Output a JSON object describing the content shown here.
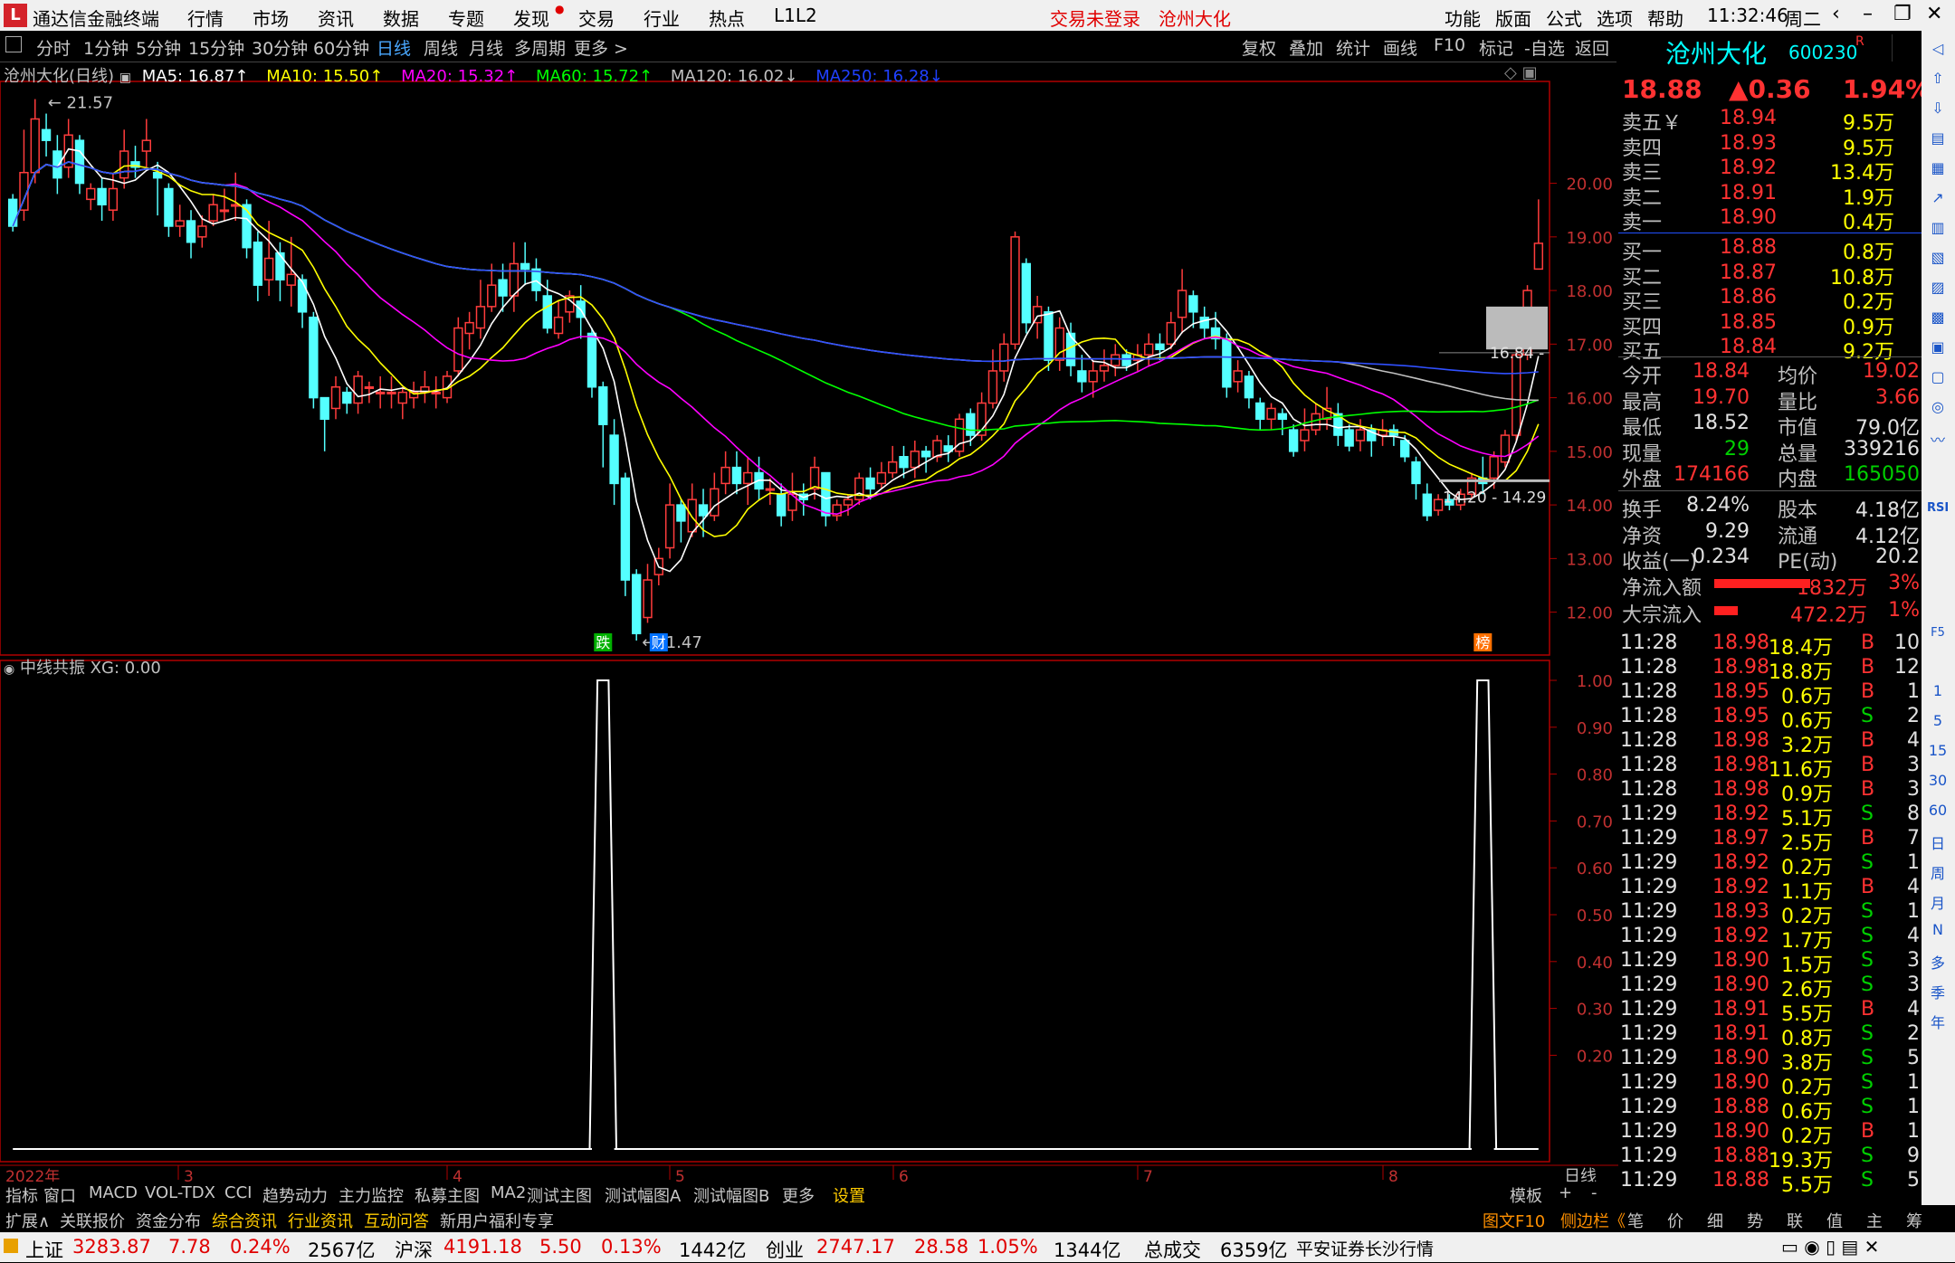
{
  "menubar": {
    "app_title": "通达信金融终端",
    "menus": [
      "行情",
      "市场",
      "资讯",
      "数据",
      "专题",
      "发现",
      "交易",
      "行业",
      "热点",
      "L1L2"
    ],
    "login_status": "交易未登录",
    "stock_name": "沧州大化",
    "right_menus": [
      "功能",
      "版面",
      "公式",
      "选项",
      "帮助"
    ],
    "time": "11:32:46",
    "weekday": "周二"
  },
  "period_bar": {
    "items": [
      "分时",
      "1分钟",
      "5分钟",
      "15分钟",
      "30分钟",
      "60分钟",
      "日线",
      "周线",
      "月线",
      "多周期",
      "更多 >"
    ],
    "selected": "日线",
    "right_items": [
      "复权",
      "叠加",
      "统计",
      "画线",
      "F10",
      "标记",
      "-自选",
      "返回"
    ]
  },
  "main_chart": {
    "title": "沧州大化(日线)",
    "ma": [
      {
        "label": "MA5: 16.87↑",
        "color": "#ffffff"
      },
      {
        "label": "MA10: 15.50↑",
        "color": "#ffff00"
      },
      {
        "label": "MA20: 15.32↑",
        "color": "#ff00ff"
      },
      {
        "label": "MA60: 15.72↑",
        "color": "#00ff00"
      },
      {
        "label": "MA120: 16.02↓",
        "color": "#c0c0c0"
      },
      {
        "label": "MA250: 16.28↓",
        "color": "#2040ff"
      }
    ],
    "y_ticks": [
      "20.00",
      "19.00",
      "18.00",
      "17.00",
      "16.00",
      "15.00",
      "14.00",
      "13.00",
      "12.00"
    ],
    "high_label": "21.57",
    "low_label": "11.47",
    "range_label_1": "16.84 -",
    "range_label_2": "14.20 - 14.29",
    "event_markers": [
      "跌",
      "财",
      "榜"
    ],
    "x_labels": [
      "2022年",
      "3",
      "4",
      "5",
      "6",
      "7",
      "8"
    ],
    "x_right_label": "日线"
  },
  "chart_data": {
    "type": "candlestick",
    "candles_ohlc": [
      [
        19.7,
        19.2,
        19.1,
        19.8
      ],
      [
        19.5,
        20.2,
        19.3,
        21.0
      ],
      [
        20.2,
        21.2,
        20.0,
        21.57
      ],
      [
        21.0,
        20.8,
        20.5,
        21.3
      ],
      [
        20.6,
        20.1,
        19.8,
        20.9
      ],
      [
        20.3,
        20.9,
        20.1,
        21.2
      ],
      [
        20.8,
        20.0,
        19.8,
        20.9
      ],
      [
        19.7,
        19.9,
        19.5,
        20.0
      ],
      [
        19.9,
        19.6,
        19.3,
        20.1
      ],
      [
        19.5,
        19.9,
        19.3,
        20.2
      ],
      [
        20.1,
        20.6,
        19.9,
        21.0
      ],
      [
        20.4,
        20.3,
        20.1,
        20.7
      ],
      [
        20.6,
        20.8,
        20.3,
        21.2
      ],
      [
        20.2,
        20.1,
        19.4,
        20.4
      ],
      [
        19.9,
        19.2,
        19.0,
        20.0
      ],
      [
        19.2,
        19.3,
        19.0,
        19.6
      ],
      [
        19.3,
        18.9,
        18.6,
        19.5
      ],
      [
        19.0,
        19.2,
        18.8,
        19.4
      ],
      [
        19.3,
        19.6,
        19.2,
        19.8
      ],
      [
        19.5,
        19.5,
        19.3,
        19.9
      ],
      [
        19.6,
        19.6,
        19.3,
        20.2
      ],
      [
        19.6,
        18.8,
        18.6,
        19.7
      ],
      [
        18.9,
        18.1,
        17.8,
        19.1
      ],
      [
        18.2,
        18.6,
        17.9,
        19.3
      ],
      [
        18.7,
        18.2,
        17.8,
        18.9
      ],
      [
        18.1,
        18.3,
        17.7,
        19.0
      ],
      [
        18.2,
        17.6,
        17.3,
        18.3
      ],
      [
        17.5,
        16.0,
        15.8,
        17.6
      ],
      [
        16.0,
        15.6,
        15.0,
        16.0
      ],
      [
        15.8,
        16.2,
        15.6,
        16.4
      ],
      [
        16.1,
        15.9,
        15.7,
        16.2
      ],
      [
        15.9,
        16.4,
        15.7,
        16.5
      ],
      [
        16.2,
        16.2,
        15.9,
        16.3
      ],
      [
        16.1,
        16.1,
        15.8,
        16.4
      ],
      [
        16.1,
        16.1,
        15.8,
        16.4
      ],
      [
        15.9,
        16.1,
        15.6,
        16.2
      ],
      [
        16.0,
        16.1,
        15.8,
        16.3
      ],
      [
        16.1,
        16.2,
        15.9,
        16.5
      ],
      [
        16.1,
        16.1,
        15.8,
        16.4
      ],
      [
        16.0,
        16.4,
        15.9,
        16.5
      ],
      [
        16.5,
        17.3,
        16.4,
        17.5
      ],
      [
        17.2,
        17.4,
        16.9,
        17.6
      ],
      [
        17.3,
        17.7,
        17.1,
        18.2
      ],
      [
        17.7,
        18.1,
        17.6,
        18.5
      ],
      [
        18.2,
        17.9,
        17.6,
        18.5
      ],
      [
        17.9,
        18.5,
        17.6,
        18.9
      ],
      [
        18.5,
        18.4,
        18.1,
        18.9
      ],
      [
        18.4,
        18.0,
        17.8,
        18.6
      ],
      [
        17.9,
        17.3,
        17.2,
        18.2
      ],
      [
        17.2,
        17.5,
        17.1,
        17.8
      ],
      [
        17.6,
        17.9,
        17.4,
        18.0
      ],
      [
        17.8,
        17.5,
        17.1,
        18.1
      ],
      [
        17.2,
        16.2,
        16.0,
        17.3
      ],
      [
        16.2,
        15.5,
        14.7,
        16.3
      ],
      [
        15.3,
        14.4,
        14.0,
        15.6
      ],
      [
        14.5,
        12.6,
        12.3,
        14.6
      ],
      [
        12.7,
        11.6,
        11.47,
        12.8
      ],
      [
        11.9,
        12.6,
        11.8,
        12.9
      ],
      [
        12.7,
        13.0,
        12.5,
        13.2
      ],
      [
        13.2,
        14.0,
        13.0,
        14.4
      ],
      [
        14.0,
        13.7,
        13.3,
        14.1
      ],
      [
        13.5,
        14.1,
        13.4,
        14.4
      ],
      [
        14.0,
        13.8,
        13.4,
        14.3
      ],
      [
        13.8,
        14.3,
        13.7,
        14.6
      ],
      [
        14.4,
        14.7,
        14.2,
        15.0
      ],
      [
        14.7,
        14.4,
        14.2,
        15.0
      ],
      [
        14.4,
        14.6,
        14.0,
        14.9
      ],
      [
        14.6,
        14.3,
        14.1,
        14.9
      ],
      [
        14.3,
        14.3,
        14.0,
        14.5
      ],
      [
        14.2,
        13.8,
        13.6,
        14.4
      ],
      [
        13.9,
        14.2,
        13.7,
        14.6
      ],
      [
        14.2,
        14.1,
        13.8,
        14.4
      ],
      [
        14.3,
        14.7,
        14.1,
        14.9
      ],
      [
        14.6,
        13.8,
        13.6,
        14.6
      ],
      [
        13.8,
        14.0,
        13.7,
        14.1
      ],
      [
        14.0,
        14.1,
        13.8,
        14.2
      ],
      [
        14.1,
        14.5,
        14.0,
        14.6
      ],
      [
        14.5,
        14.3,
        14.1,
        14.7
      ],
      [
        14.4,
        14.6,
        14.3,
        14.8
      ],
      [
        14.6,
        14.8,
        14.5,
        15.1
      ],
      [
        14.9,
        14.7,
        14.5,
        15.1
      ],
      [
        14.7,
        15.0,
        14.5,
        15.2
      ],
      [
        15.0,
        14.9,
        14.6,
        15.1
      ],
      [
        14.9,
        15.2,
        14.8,
        15.3
      ],
      [
        15.1,
        15.0,
        14.8,
        15.3
      ],
      [
        15.0,
        15.6,
        14.9,
        15.7
      ],
      [
        15.7,
        15.3,
        15.1,
        15.8
      ],
      [
        15.3,
        15.9,
        15.2,
        16.1
      ],
      [
        15.9,
        16.5,
        15.8,
        16.9
      ],
      [
        16.5,
        17.0,
        16.3,
        17.2
      ],
      [
        17.0,
        19.0,
        16.9,
        19.1
      ],
      [
        18.5,
        17.4,
        17.2,
        18.6
      ],
      [
        17.4,
        17.7,
        17.1,
        17.9
      ],
      [
        17.6,
        16.7,
        16.5,
        17.7
      ],
      [
        16.7,
        17.3,
        16.5,
        17.5
      ],
      [
        17.2,
        16.6,
        16.4,
        17.4
      ],
      [
        16.5,
        16.3,
        16.1,
        16.8
      ],
      [
        16.3,
        16.5,
        16.0,
        16.7
      ],
      [
        16.5,
        16.6,
        16.3,
        16.9
      ],
      [
        16.6,
        16.8,
        16.4,
        17.0
      ],
      [
        16.8,
        16.6,
        16.5,
        16.9
      ],
      [
        16.7,
        16.8,
        16.5,
        17.0
      ],
      [
        16.8,
        17.0,
        16.6,
        17.2
      ],
      [
        17.0,
        16.9,
        16.7,
        17.2
      ],
      [
        17.0,
        17.4,
        16.9,
        17.6
      ],
      [
        17.5,
        18.0,
        17.2,
        18.4
      ],
      [
        17.9,
        17.6,
        17.3,
        18.0
      ],
      [
        17.5,
        17.3,
        17.1,
        17.7
      ],
      [
        17.3,
        17.1,
        16.9,
        17.6
      ],
      [
        17.1,
        16.2,
        16.0,
        17.2
      ],
      [
        16.3,
        16.5,
        16.1,
        16.7
      ],
      [
        16.4,
        16.0,
        15.8,
        16.5
      ],
      [
        15.9,
        15.6,
        15.4,
        16.0
      ],
      [
        15.6,
        15.8,
        15.4,
        15.9
      ],
      [
        15.7,
        15.6,
        15.3,
        15.8
      ],
      [
        15.4,
        15.0,
        14.9,
        15.5
      ],
      [
        15.2,
        15.4,
        15.0,
        15.8
      ],
      [
        15.4,
        15.7,
        15.3,
        15.9
      ],
      [
        15.6,
        15.8,
        15.4,
        16.2
      ],
      [
        15.7,
        15.3,
        15.1,
        15.9
      ],
      [
        15.4,
        15.1,
        15.0,
        15.5
      ],
      [
        15.2,
        15.4,
        15.0,
        15.6
      ],
      [
        15.4,
        15.2,
        14.9,
        15.5
      ],
      [
        15.3,
        15.4,
        15.1,
        15.6
      ],
      [
        15.4,
        15.3,
        15.1,
        15.5
      ],
      [
        15.2,
        14.9,
        14.8,
        15.3
      ],
      [
        14.8,
        14.4,
        14.1,
        14.9
      ],
      [
        14.2,
        13.8,
        13.7,
        14.4
      ],
      [
        13.9,
        14.1,
        13.8,
        14.2
      ],
      [
        14.1,
        14.0,
        13.9,
        14.2
      ],
      [
        14.0,
        14.2,
        13.9,
        14.3
      ],
      [
        14.2,
        14.5,
        14.1,
        14.6
      ],
      [
        14.5,
        14.4,
        14.2,
        14.9
      ],
      [
        14.5,
        14.9,
        14.3,
        15.0
      ],
      [
        14.8,
        15.3,
        14.7,
        15.4
      ],
      [
        15.3,
        16.8,
        15.2,
        16.9
      ],
      [
        16.8,
        18.0,
        16.7,
        18.1
      ],
      [
        18.4,
        18.88,
        18.52,
        19.7
      ]
    ],
    "ylim": [
      11.2,
      21.9
    ],
    "sub_chart": {
      "title": "中线共振  XG: 0.00",
      "y_ticks": [
        "1.00",
        "0.90",
        "0.80",
        "0.70",
        "0.60",
        "0.50",
        "0.40",
        "0.30",
        "0.20"
      ],
      "ylim": [
        0,
        1.0
      ],
      "signal_indices": [
        53,
        132
      ]
    }
  },
  "quote": {
    "name": "沧州大化",
    "code": "600230",
    "badge": "R",
    "price": "18.88",
    "change": "▲0.36",
    "pct": "1.94%",
    "asks": [
      {
        "label": "卖五￥",
        "price": "18.94",
        "vol": "9.5万"
      },
      {
        "label": "卖四",
        "price": "18.93",
        "vol": "9.5万"
      },
      {
        "label": "卖三",
        "price": "18.92",
        "vol": "13.4万"
      },
      {
        "label": "卖二",
        "price": "18.91",
        "vol": "1.9万"
      },
      {
        "label": "卖一",
        "price": "18.90",
        "vol": "0.4万"
      }
    ],
    "bids": [
      {
        "label": "买一",
        "price": "18.88",
        "vol": "0.8万"
      },
      {
        "label": "买二",
        "price": "18.87",
        "vol": "10.8万"
      },
      {
        "label": "买三",
        "price": "18.86",
        "vol": "0.2万"
      },
      {
        "label": "买四",
        "price": "18.85",
        "vol": "0.9万"
      },
      {
        "label": "买五",
        "price": "18.84",
        "vol": "9.2万"
      }
    ],
    "stats": [
      {
        "l1": "今开",
        "v1": "18.84",
        "c1": "red",
        "l2": "均价",
        "v2": "19.02",
        "c2": "red"
      },
      {
        "l1": "最高",
        "v1": "19.70",
        "c1": "red",
        "l2": "量比",
        "v2": "3.66",
        "c2": "red"
      },
      {
        "l1": "最低",
        "v1": "18.52",
        "c1": "wht",
        "l2": "市值",
        "v2": "79.0亿",
        "c2": "wht"
      },
      {
        "l1": "现量",
        "v1": "29",
        "c1": "grn",
        "l2": "总量",
        "v2": "339216",
        "c2": "wht"
      },
      {
        "l1": "外盘",
        "v1": "174166",
        "c1": "red",
        "l2": "内盘",
        "v2": "165050",
        "c2": "grn"
      }
    ],
    "stats2": [
      {
        "l1": "换手",
        "v1": "8.24%",
        "l2": "股本",
        "v2": "4.18亿"
      },
      {
        "l1": "净资",
        "v1": "9.29",
        "l2": "流通",
        "v2": "4.12亿"
      },
      {
        "l1": "收益(一)",
        "v1": "0.234",
        "l2": "PE(动)",
        "v2": "20.2"
      }
    ],
    "flows": [
      {
        "label": "净流入额",
        "value": "1832万",
        "pct": "3%",
        "bar": 66
      },
      {
        "label": "大宗流入",
        "value": "472.2万",
        "pct": "1%",
        "bar": 16
      }
    ],
    "ticks": [
      {
        "t": "11:28",
        "p": "18.98",
        "pc": "red",
        "v": "18.4万",
        "s": "B",
        "n": "10"
      },
      {
        "t": "11:28",
        "p": "18.98",
        "pc": "red",
        "v": "18.8万",
        "s": "B",
        "n": "12"
      },
      {
        "t": "11:28",
        "p": "18.95",
        "pc": "red",
        "v": "0.6万",
        "s": "B",
        "n": "1"
      },
      {
        "t": "11:28",
        "p": "18.95",
        "pc": "red",
        "v": "0.6万",
        "s": "S",
        "n": "2"
      },
      {
        "t": "11:28",
        "p": "18.98",
        "pc": "red",
        "v": "3.2万",
        "s": "B",
        "n": "4"
      },
      {
        "t": "11:28",
        "p": "18.98",
        "pc": "red",
        "v": "11.6万",
        "s": "B",
        "n": "3"
      },
      {
        "t": "11:28",
        "p": "18.98",
        "pc": "red",
        "v": "0.9万",
        "s": "B",
        "n": "3"
      },
      {
        "t": "11:29",
        "p": "18.92",
        "pc": "red",
        "v": "5.1万",
        "s": "S",
        "n": "8"
      },
      {
        "t": "11:29",
        "p": "18.97",
        "pc": "red",
        "v": "2.5万",
        "s": "B",
        "n": "7"
      },
      {
        "t": "11:29",
        "p": "18.92",
        "pc": "red",
        "v": "0.2万",
        "s": "S",
        "n": "1"
      },
      {
        "t": "11:29",
        "p": "18.92",
        "pc": "red",
        "v": "1.1万",
        "s": "B",
        "n": "4"
      },
      {
        "t": "11:29",
        "p": "18.93",
        "pc": "red",
        "v": "0.2万",
        "s": "S",
        "n": "1"
      },
      {
        "t": "11:29",
        "p": "18.92",
        "pc": "red",
        "v": "1.7万",
        "s": "S",
        "n": "4"
      },
      {
        "t": "11:29",
        "p": "18.90",
        "pc": "red",
        "v": "1.5万",
        "s": "S",
        "n": "3"
      },
      {
        "t": "11:29",
        "p": "18.90",
        "pc": "red",
        "v": "2.6万",
        "s": "S",
        "n": "3"
      },
      {
        "t": "11:29",
        "p": "18.91",
        "pc": "red",
        "v": "5.5万",
        "s": "B",
        "n": "4"
      },
      {
        "t": "11:29",
        "p": "18.91",
        "pc": "red",
        "v": "0.8万",
        "s": "S",
        "n": "2"
      },
      {
        "t": "11:29",
        "p": "18.90",
        "pc": "red",
        "v": "3.8万",
        "s": "S",
        "n": "5"
      },
      {
        "t": "11:29",
        "p": "18.90",
        "pc": "red",
        "v": "0.2万",
        "s": "S",
        "n": "1"
      },
      {
        "t": "11:29",
        "p": "18.88",
        "pc": "red",
        "v": "0.6万",
        "s": "S",
        "n": "1"
      },
      {
        "t": "11:29",
        "p": "18.90",
        "pc": "red",
        "v": "0.2万",
        "s": "B",
        "n": "1"
      },
      {
        "t": "11:29",
        "p": "18.88",
        "pc": "red",
        "v": "19.3万",
        "s": "S",
        "n": "9"
      },
      {
        "t": "11:29",
        "p": "18.88",
        "pc": "red",
        "v": "5.5万",
        "s": "S",
        "n": "5"
      }
    ]
  },
  "sidebar": [
    "1",
    "5",
    "15",
    "30",
    "60",
    "日",
    "周",
    "月",
    "N",
    "多",
    "季",
    "年"
  ],
  "sidebar_icons": [
    "RSI",
    "F5"
  ],
  "bottom_tabs": [
    "指标",
    "窗口",
    "MACD",
    "VOL-TDX",
    "CCI",
    "趋势动力",
    "主力监控",
    "私募主图",
    "MA2",
    "测试主图",
    "测试幅图A",
    "测试幅图B",
    "更多",
    "设置"
  ],
  "bottom_right": [
    "模板",
    "+",
    "-"
  ],
  "bottom_tabs2": [
    "扩展∧",
    "关联报价",
    "资金分布",
    "综合资讯",
    "行业资讯",
    "互动问答",
    "新用户福利专享"
  ],
  "bottom_right2": [
    "图文F10",
    "侧边栏《",
    "笔",
    "价",
    "细",
    "势",
    "联",
    "值",
    "主",
    "筹"
  ],
  "status": {
    "sh_label": "上证",
    "sh": "3283.87",
    "sh_chg": "7.78",
    "sh_pct": "0.24%",
    "sh_amt": "2567亿",
    "hs_label": "沪深",
    "hs": "4191.18",
    "hs_chg": "5.50",
    "hs_pct": "0.13%",
    "hs_amt": "1442亿",
    "cy_label": "创业",
    "cy": "2747.17",
    "cy_chg": "28.58",
    "cy_pct": "1.05%",
    "cy_amt": "1344亿",
    "total_label": "总成交",
    "total": "6359亿",
    "broker": "平安证券长沙行情"
  }
}
